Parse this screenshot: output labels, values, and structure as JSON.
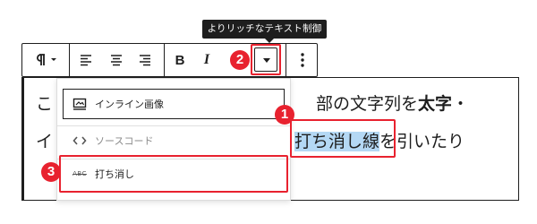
{
  "tooltip": {
    "text": "よりリッチなテキスト制御"
  },
  "toolbar": {
    "paragraph_icon": "pilcrow-icon",
    "align_left_icon": "align-left-icon",
    "align_center_icon": "align-center-icon",
    "align_right_icon": "align-right-icon",
    "bold_label": "B",
    "italic_label": "I",
    "more_icon": "chevron-down-icon",
    "options_icon": "more-vertical-icon"
  },
  "editor": {
    "line1_start": "こ",
    "line1_end_normal": "部の文字列を",
    "line1_end_bold": "太字",
    "line1_end_tail": "・",
    "line2_start": "イ",
    "line2_highlight": "打ち消し線",
    "line2_tail": "を引いたり"
  },
  "dropdown": {
    "items": [
      {
        "label": "インライン画像",
        "icon": "inline-image-icon"
      },
      {
        "label": "ソースコード",
        "icon": "code-icon",
        "disabled": true
      },
      {
        "label": "打ち消し",
        "icon": "strikethrough-icon",
        "icon_text": "ABC"
      }
    ]
  },
  "annotations": {
    "badge_1": "1",
    "badge_2": "2",
    "badge_3": "3",
    "accent_color": "#e8222f",
    "highlight_color": "#b4d8f4"
  }
}
